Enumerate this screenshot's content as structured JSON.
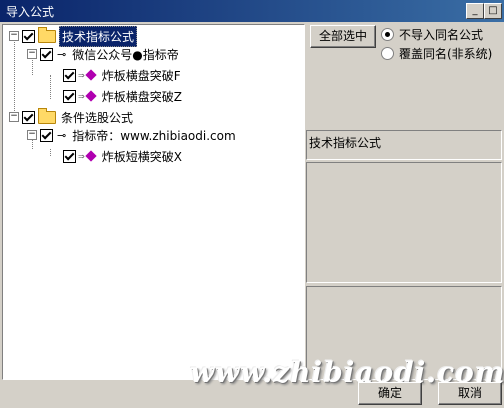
{
  "window": {
    "title": "导入公式",
    "min_label": "_",
    "max_label": "□"
  },
  "tree": {
    "groups": [
      {
        "label": "技术指标公式",
        "source": "微信公众号●指标帝",
        "items": [
          "炸板横盘突破F",
          "炸板横盘突破Z"
        ]
      },
      {
        "label": "条件选股公式",
        "source": "指标帝：www.zhibiaodi.com",
        "items": [
          "炸板短横突破X"
        ]
      }
    ]
  },
  "options": {
    "select_all": "全部选中",
    "radio_no_import": "不导入同名公式",
    "radio_overwrite": "覆盖同名(非系统)"
  },
  "info": {
    "type_label": "技术指标公式"
  },
  "footer": {
    "ok": "确定",
    "cancel": "取消"
  },
  "watermark": "www.zhibiaodi.com"
}
